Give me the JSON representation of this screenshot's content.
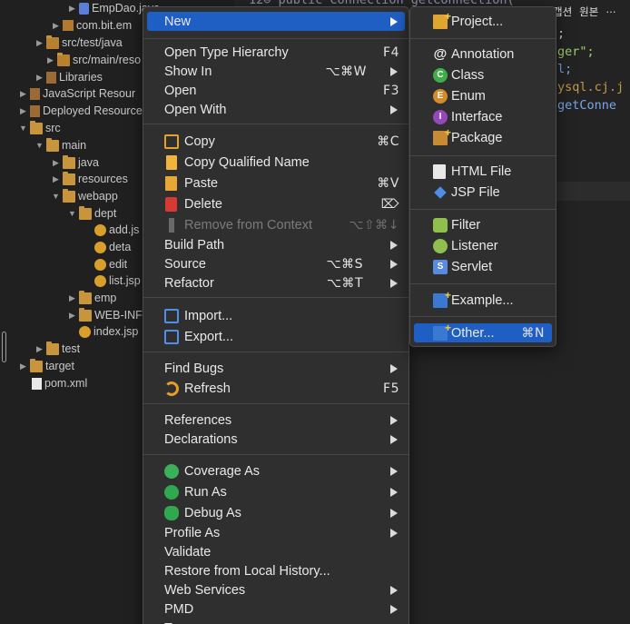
{
  "explorer": {
    "items": [
      {
        "label": "EmpDao.java",
        "twisty": "▶",
        "icon": "java-file-icon"
      },
      {
        "label": "com.bit.em",
        "twisty": "▶",
        "icon": "package-icon"
      },
      {
        "label": "src/test/java",
        "twisty": "▶",
        "icon": "source-folder-icon"
      },
      {
        "label": "src/main/reso",
        "twisty": "▶",
        "icon": "source-folder-icon"
      },
      {
        "label": "Libraries",
        "twisty": "▶",
        "icon": "library-icon"
      },
      {
        "label": "JavaScript Resour",
        "twisty": "▶",
        "icon": "library-icon"
      },
      {
        "label": "Deployed Resource",
        "twisty": "▶",
        "icon": "library-icon"
      },
      {
        "label": "src",
        "twisty": "▼",
        "icon": "folder-icon"
      },
      {
        "label": "main",
        "twisty": "▼",
        "icon": "folder-icon"
      },
      {
        "label": "java",
        "twisty": "▶",
        "icon": "folder-icon"
      },
      {
        "label": "resources",
        "twisty": "▶",
        "icon": "folder-icon"
      },
      {
        "label": "webapp",
        "twisty": "▼",
        "icon": "folder-icon"
      },
      {
        "label": "dept",
        "twisty": "▼",
        "icon": "folder-icon"
      },
      {
        "label": "add.js",
        "twisty": "",
        "icon": "jsp-file-icon"
      },
      {
        "label": "deta",
        "twisty": "",
        "icon": "jsp-file-icon"
      },
      {
        "label": "edit",
        "twisty": "",
        "icon": "jsp-file-icon"
      },
      {
        "label": "list.jsp",
        "twisty": "",
        "icon": "jsp-file-icon"
      },
      {
        "label": "emp",
        "twisty": "▶",
        "icon": "folder-icon"
      },
      {
        "label": "WEB-INF",
        "twisty": "▶",
        "icon": "folder-icon"
      },
      {
        "label": "index.jsp",
        "twisty": "",
        "icon": "jsp-file-icon"
      },
      {
        "label": "test",
        "twisty": "▶",
        "icon": "folder-icon"
      },
      {
        "label": "target",
        "twisty": "▶",
        "icon": "folder-icon"
      },
      {
        "label": "pom.xml",
        "twisty": "",
        "icon": "xml-file-icon"
      }
    ]
  },
  "editor": {
    "lines": [
      {
        "text": "12⊖    public Connection getConnection(",
        "color": "#8a8fa8"
      },
      {
        "text": ";",
        "color": "#d6d6d6"
      },
      {
        "text": "ger\";",
        "color": "#9ccf6a"
      },
      {
        "text": "l;",
        "color": "#7aa6e8"
      },
      {
        "text": "ysql.cj.j",
        "color": "#c49a4a"
      },
      {
        "text": "getConne",
        "color": "#7aa6e8"
      }
    ]
  },
  "topbar": {
    "caption_label": "캡션",
    "original_label": "원본",
    "more_label": "⋯"
  },
  "main_menu": {
    "items": [
      {
        "label": "New",
        "shortcut": "",
        "submenu": true,
        "icon": "",
        "state": "highlight"
      },
      {
        "label": "Open Type Hierarchy",
        "shortcut": "F4",
        "submenu": false,
        "icon": ""
      },
      {
        "label": "Show In",
        "shortcut": "⌥⌘W",
        "submenu": true,
        "icon": ""
      },
      {
        "label": "Open",
        "shortcut": "F3",
        "submenu": false,
        "icon": ""
      },
      {
        "label": "Open With",
        "shortcut": "",
        "submenu": true,
        "icon": ""
      },
      {
        "label": "Copy",
        "shortcut": "⌘C",
        "submenu": false,
        "icon": "copy-icon"
      },
      {
        "label": "Copy Qualified Name",
        "shortcut": "",
        "submenu": false,
        "icon": "copy-qualified-name-icon"
      },
      {
        "label": "Paste",
        "shortcut": "⌘V",
        "submenu": false,
        "icon": "paste-icon"
      },
      {
        "label": "Delete",
        "shortcut": "⌦",
        "submenu": false,
        "icon": "delete-icon"
      },
      {
        "label": "Remove from Context",
        "shortcut": "⌥⇧⌘↓",
        "submenu": false,
        "icon": "remove-from-context-icon",
        "state": "disabled"
      },
      {
        "label": "Build Path",
        "shortcut": "",
        "submenu": true,
        "icon": ""
      },
      {
        "label": "Source",
        "shortcut": "⌥⌘S",
        "submenu": true,
        "icon": ""
      },
      {
        "label": "Refactor",
        "shortcut": "⌥⌘T",
        "submenu": true,
        "icon": ""
      },
      {
        "label": "Import...",
        "shortcut": "",
        "submenu": false,
        "icon": "import-icon"
      },
      {
        "label": "Export...",
        "shortcut": "",
        "submenu": false,
        "icon": "export-icon"
      },
      {
        "label": "Find Bugs",
        "shortcut": "",
        "submenu": true,
        "icon": ""
      },
      {
        "label": "Refresh",
        "shortcut": "F5",
        "submenu": false,
        "icon": "refresh-icon"
      },
      {
        "label": "References",
        "shortcut": "",
        "submenu": true,
        "icon": ""
      },
      {
        "label": "Declarations",
        "shortcut": "",
        "submenu": true,
        "icon": ""
      },
      {
        "label": "Coverage As",
        "shortcut": "",
        "submenu": true,
        "icon": "coverage-icon"
      },
      {
        "label": "Run As",
        "shortcut": "",
        "submenu": true,
        "icon": "run-icon"
      },
      {
        "label": "Debug As",
        "shortcut": "",
        "submenu": true,
        "icon": "debug-icon"
      },
      {
        "label": "Profile As",
        "shortcut": "",
        "submenu": true,
        "icon": ""
      },
      {
        "label": "Validate",
        "shortcut": "",
        "submenu": false,
        "icon": ""
      },
      {
        "label": "Restore from Local History...",
        "shortcut": "",
        "submenu": false,
        "icon": ""
      },
      {
        "label": "Web Services",
        "shortcut": "",
        "submenu": true,
        "icon": ""
      },
      {
        "label": "PMD",
        "shortcut": "",
        "submenu": true,
        "icon": ""
      },
      {
        "label": "T",
        "shortcut": "",
        "submenu": true,
        "icon": ""
      }
    ]
  },
  "sub_menu": {
    "items": [
      {
        "label": "Project...",
        "shortcut": "",
        "icon": "new-project-icon"
      },
      {
        "label": "Annotation",
        "shortcut": "",
        "icon": "annotation-icon"
      },
      {
        "label": "Class",
        "shortcut": "",
        "icon": "class-icon"
      },
      {
        "label": "Enum",
        "shortcut": "",
        "icon": "enum-icon"
      },
      {
        "label": "Interface",
        "shortcut": "",
        "icon": "interface-icon"
      },
      {
        "label": "Package",
        "shortcut": "",
        "icon": "package-icon"
      },
      {
        "label": "HTML File",
        "shortcut": "",
        "icon": "html-file-icon"
      },
      {
        "label": "JSP File",
        "shortcut": "",
        "icon": "jsp-file-icon"
      },
      {
        "label": "Filter",
        "shortcut": "",
        "icon": "filter-icon"
      },
      {
        "label": "Listener",
        "shortcut": "",
        "icon": "listener-icon"
      },
      {
        "label": "Servlet",
        "shortcut": "",
        "icon": "servlet-icon"
      },
      {
        "label": "Example...",
        "shortcut": "",
        "icon": "example-icon"
      },
      {
        "label": "Other...",
        "shortcut": "⌘N",
        "icon": "other-wizard-icon",
        "state": "highlight"
      }
    ]
  },
  "colors": {
    "highlight": "#1f5fc4",
    "menu_bg": "#2f2f2f",
    "disabled_text": "#7b7b7b"
  }
}
